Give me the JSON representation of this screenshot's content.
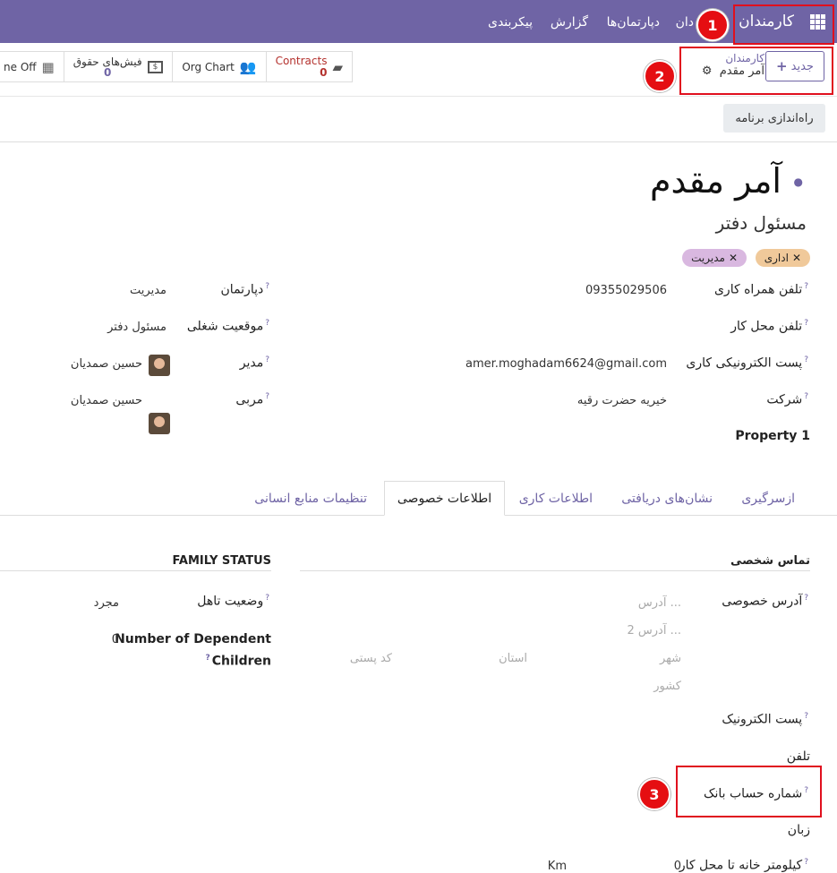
{
  "topbar": {
    "app_name": "کارمندان",
    "nav_items": [
      "دان",
      "دپارتمان‌ها",
      "گزارش",
      "پیکربندی"
    ]
  },
  "annotations": [
    "1",
    "2",
    "3"
  ],
  "control_panel": {
    "new_button": "جدید",
    "breadcrumb_parent": "کارمندان",
    "breadcrumb_current": "آمر مقدم",
    "stats": [
      {
        "label": "Contracts",
        "value": "0"
      },
      {
        "label": "Org Chart"
      },
      {
        "label": "فیش‌های حقوق",
        "value": "0"
      },
      {
        "label": "ne Off"
      }
    ],
    "launch_button": "راه‌اندازی برنامه"
  },
  "employee": {
    "name": "آمر مقدم",
    "job_title": "مسئول دفتر",
    "tags": [
      "اداری",
      "مدیریت"
    ]
  },
  "fields_right": [
    {
      "label": "تلفن همراه کاری",
      "value": "09355029506"
    },
    {
      "label": "تلفن محل کار",
      "value": ""
    },
    {
      "label": "پست الکترونیکی کاری",
      "value": "amer.moghadam6624@gmail.com"
    },
    {
      "label": "شرکت",
      "value": "خیریه حضرت رقیه"
    },
    {
      "label": "Property 1",
      "value": ""
    }
  ],
  "fields_left": [
    {
      "label": "دپارتمان",
      "value": "مدیریت"
    },
    {
      "label": "موقعیت شغلی",
      "value": "مسئول دفتر"
    },
    {
      "label": "مدیر",
      "value": "حسین صمدیان"
    },
    {
      "label": "مربی",
      "value": "حسین صمدیان"
    }
  ],
  "tabs": [
    "ازسرگیری",
    "نشان‌های دریافتی",
    "اطلاعات کاری",
    "اطلاعات خصوصی",
    "تنظیمات منابع انسانی"
  ],
  "private": {
    "contact_title": "تماس شخصی",
    "address_label": "آدرس خصوصی",
    "address_placeholders": {
      "street": "آدرس ...",
      "street2": "آدرس 2 ...",
      "city": "شهر",
      "state": "استان",
      "zip": "کد پستی",
      "country": "کشور"
    },
    "email_label": "پست الکترونیک",
    "phone_label": "تلفن",
    "bank_label": "شماره حساب بانک",
    "lang_label": "زبان",
    "km_label": "کیلومتر خانه تا محل کار",
    "km_value": "0",
    "km_unit": "Km"
  },
  "family": {
    "title": "FAMILY STATUS",
    "marital_label": "وضعیت تاهل",
    "marital_value": "مجرد",
    "children_label_1": "Number of Dependent",
    "children_label_2": "Children",
    "children_value": "0"
  },
  "colors": {
    "brand": "#6f64a5",
    "annotation_red": "#e50e12"
  }
}
